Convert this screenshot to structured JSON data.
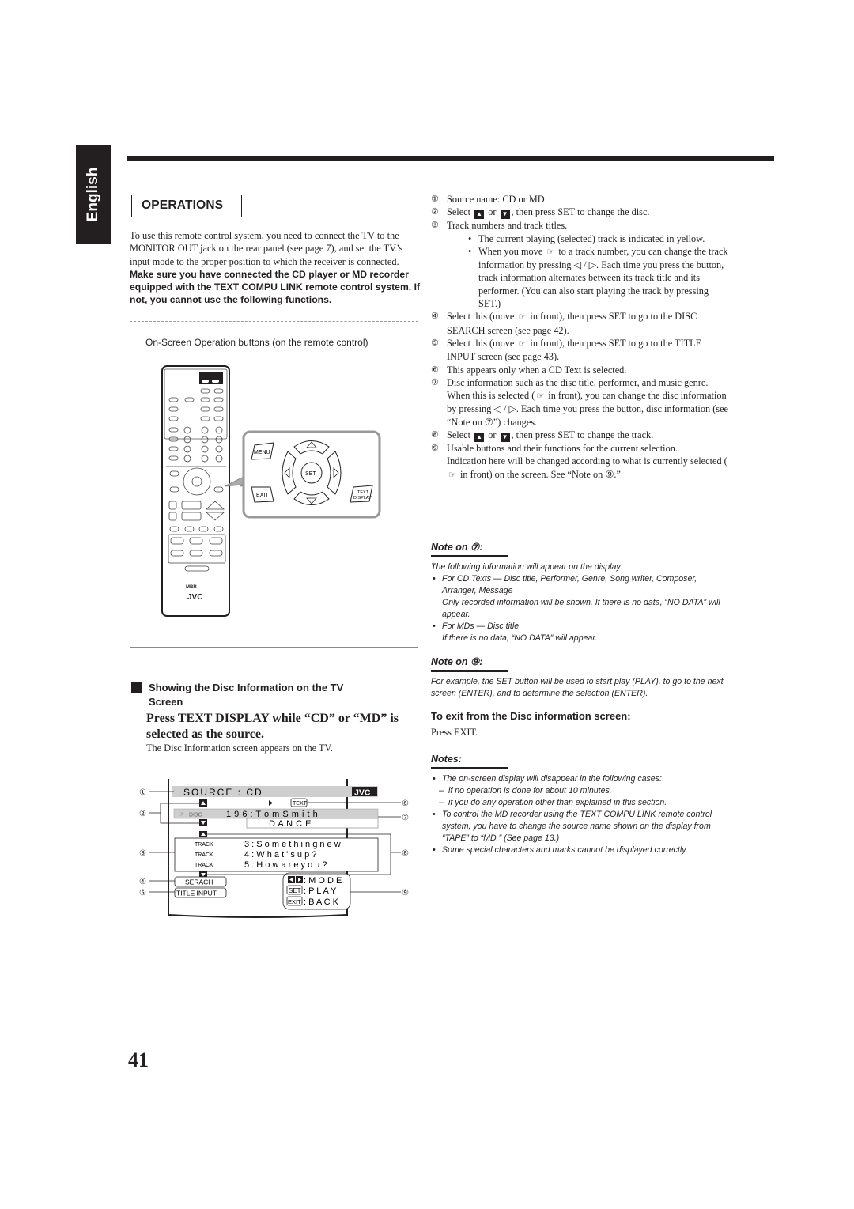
{
  "side_tab": {
    "label": "English"
  },
  "section": {
    "title": "OPERATIONS"
  },
  "intro": {
    "normal": "To use this remote control system, you need to connect the TV to the MONITOR OUT jack on the rear panel (see page 7), and set the TV’s input mode to the proper position to which the receiver is connected. ",
    "bold": "Make sure you have connected the CD player or MD recorder equipped with the TEXT COMPU LINK remote control system. If not, you cannot use the following functions."
  },
  "figure": {
    "caption": "On-Screen Operation buttons (on the remote control)",
    "buttons": {
      "menu": "MENU",
      "set": "SET",
      "exit": "EXIT",
      "text_display_1": "TEXT",
      "text_display_2": "DISPLAY"
    },
    "remote_brand": "JVC",
    "remote_logo": "MBR"
  },
  "subsection": {
    "title_line1": "Showing the Disc Information on the TV",
    "title_line2": "Screen",
    "instruction": "Press TEXT DISPLAY while “CD” or “MD” is selected as the source.",
    "result": "The Disc Information screen appears on the TV."
  },
  "tv_screen": {
    "source": "SOURCE :  CD",
    "brand": "JVC",
    "text_badge": "TEXT",
    "disc_label": "DISC",
    "disc_info_line1": "1 9 6 :   T o m   S m i t h",
    "disc_info_line2": "D A N C E",
    "tracks": [
      {
        "label": "TRACK",
        "text": "3 : S o m e t h i n g   n e w"
      },
      {
        "label": "TRACK",
        "text": "4 : W h a t ' s   u p ?"
      },
      {
        "label": "TRACK",
        "text": "5 : H o w   a r e   y o u ?"
      }
    ],
    "search_button": "SERACH",
    "title_input_button": "TITLE INPUT",
    "functions": [
      {
        "key": "◀▶",
        "label": ": M O D E"
      },
      {
        "key": "SET",
        "label": ": P L A Y"
      },
      {
        "key": "EXIT",
        "label": ": B A C K"
      }
    ],
    "callouts": [
      "①",
      "②",
      "③",
      "④",
      "⑤",
      "⑥",
      "⑦",
      "⑧",
      "⑨"
    ]
  },
  "legend": {
    "items": [
      {
        "num": "①",
        "text": "Source name: CD or MD"
      },
      {
        "num": "②",
        "text_a": "Select",
        "text_b": "or",
        "text_c": ", then press SET to change the disc."
      },
      {
        "num": "③",
        "text": "Track numbers and track titles."
      },
      {
        "bullet1": "The current playing (selected) track is indicated in yellow."
      },
      {
        "bullet2_a": "When you move",
        "bullet2_b": "to a track number, you can change the track information by pressing ◁ / ▷. Each time you press the button, track information alternates between its track title and its performer. (You can also start playing the track by pressing SET.)"
      },
      {
        "num": "④",
        "text_a": "Select this (move",
        "text_b": "in front), then press SET to go to the DISC SEARCH screen (see page 42)."
      },
      {
        "num": "⑤",
        "text_a": "Select this (move",
        "text_b": "in front), then press SET to go to the TITLE INPUT screen (see page 43)."
      },
      {
        "num": "⑥",
        "text": "This appears only when a CD Text is selected."
      },
      {
        "num": "⑦",
        "text": "Disc information such as the disc title, performer, and music genre.",
        "cont_a": "When this is selected (",
        "cont_b": "in front), you can change the disc information by pressing ◁ / ▷. Each time you press the button, disc information (see “Note on ⑦”) changes."
      },
      {
        "num": "⑧",
        "text_a": "Select",
        "text_b": "or",
        "text_c": ", then press SET to change the track."
      },
      {
        "num": "⑨",
        "text": "Usable buttons and their functions for the current selection.",
        "cont_a": "Indication here will be changed according to what is currently selected (",
        "cont_b": "in front) on the screen. See “Note on ⑨.”"
      }
    ]
  },
  "note7": {
    "title": "Note on ⑦:",
    "intro": "The following information will appear on the display:",
    "b1": "For CD Texts — Disc title, Performer, Genre, Song writer, Composer, Arranger, Message",
    "b1_cont": "Only recorded information will be shown. If there is no data, “NO DATA” will appear.",
    "b2": "For MDs — Disc title",
    "b2_cont": "If there is no data, “NO DATA” will appear."
  },
  "note9": {
    "title": "Note on ⑨:",
    "text": "For example, the SET button will be used to start play (PLAY), to go to the next screen (ENTER), and to determine the selection (ENTER)."
  },
  "exit_section": {
    "title": "To exit from the Disc information screen:",
    "text": "Press EXIT."
  },
  "notes": {
    "title": "Notes:",
    "b1": "The on-screen display will disappear in the following cases:",
    "d1": "if no operation is done for about 10 minutes.",
    "d2": "if you do any operation other than explained in this section.",
    "b2": "To control the MD recorder using the TEXT COMPU LINK remote control system, you have to change the source name shown on the display from “TAPE” to “MD.” (See page 13.)",
    "b3": "Some special characters and marks cannot be displayed correctly."
  },
  "page_number": "41"
}
